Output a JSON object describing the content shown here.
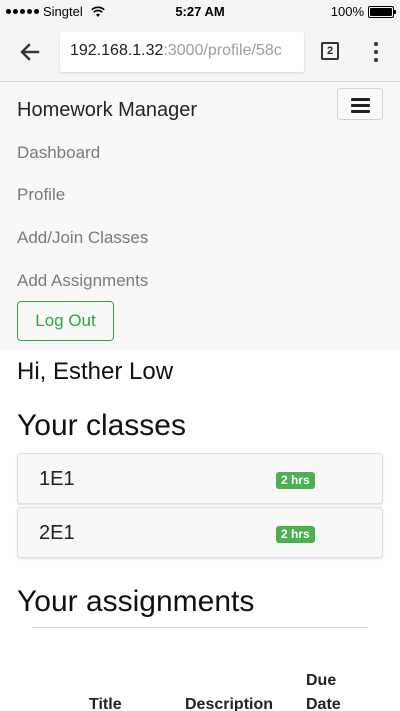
{
  "status_bar": {
    "carrier": "Singtel",
    "time": "5:27 AM",
    "battery": "100%",
    "battery_level": 1.0
  },
  "browser": {
    "url_host": "192.168.1.32",
    "url_path": ":3000/profile/58c",
    "tab_count": "2",
    "icons": {
      "back": "back-arrow-icon",
      "menu": "more-vert-icon"
    }
  },
  "navbar": {
    "brand": "Homework Manager",
    "links": [
      "Dashboard",
      "Profile",
      "Add/Join Classes",
      "Add Assignments"
    ],
    "logout_label": "Log Out",
    "accent": "#28a745"
  },
  "greeting": "Hi, Esther Low",
  "classes": {
    "heading": "Your classes",
    "items": [
      {
        "name": "1E1",
        "badge": "2 hrs"
      },
      {
        "name": "2E1",
        "badge": "2 hrs"
      }
    ],
    "badge_color": "#4caf50"
  },
  "assignments": {
    "heading": "Your assignments",
    "columns": [
      "Title",
      "Description",
      "Due",
      "Date"
    ]
  }
}
